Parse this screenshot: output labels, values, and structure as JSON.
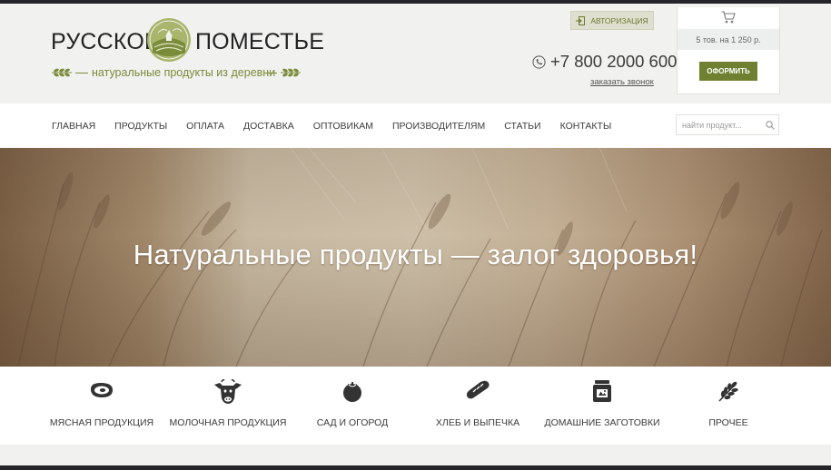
{
  "brand": {
    "name_left": "РУССКОЕ",
    "name_right": "ПОМЕСТЬЕ",
    "tagline": "натуральные продукты из деревни"
  },
  "header": {
    "auth_label": "АВТОРИЗАЦИЯ",
    "phone": "+7 800 2000 600",
    "callback_label": "заказать звонок"
  },
  "cart": {
    "summary": "5 тов. на 1 250 р.",
    "checkout_label": "ОФОРМИТЬ"
  },
  "nav": {
    "items": [
      {
        "label": "ГЛАВНАЯ"
      },
      {
        "label": "ПРОДУКТЫ"
      },
      {
        "label": "ОПЛАТА"
      },
      {
        "label": "ДОСТАВКА"
      },
      {
        "label": "ОПТОВИКАМ"
      },
      {
        "label": "ПРОИЗВОДИТЕЛЯМ"
      },
      {
        "label": "СТАТЬИ"
      },
      {
        "label": "КОНТАКТЫ"
      }
    ],
    "search_placeholder": "найти продукт..."
  },
  "hero": {
    "slogan": "Натуральные продукты — залог здоровья!"
  },
  "categories": [
    {
      "label": "МЯСНАЯ ПРОДУКЦИЯ",
      "icon": "meat-icon"
    },
    {
      "label": "МОЛОЧНАЯ ПРОДУКЦИЯ",
      "icon": "cow-icon"
    },
    {
      "label": "САД И ОГОРОД",
      "icon": "tomato-icon"
    },
    {
      "label": "ХЛЕБ И ВЫПЕЧКА",
      "icon": "bread-icon"
    },
    {
      "label": "ДОМАШНИЕ ЗАГОТОВКИ",
      "icon": "jar-icon"
    },
    {
      "label": "ПРОЧЕЕ",
      "icon": "wheat-icon"
    }
  ],
  "colors": {
    "accent": "#6f8130",
    "accent_text": "#7a8b3a",
    "dark": "#26262a",
    "header_bg": "#f1f1ef"
  }
}
